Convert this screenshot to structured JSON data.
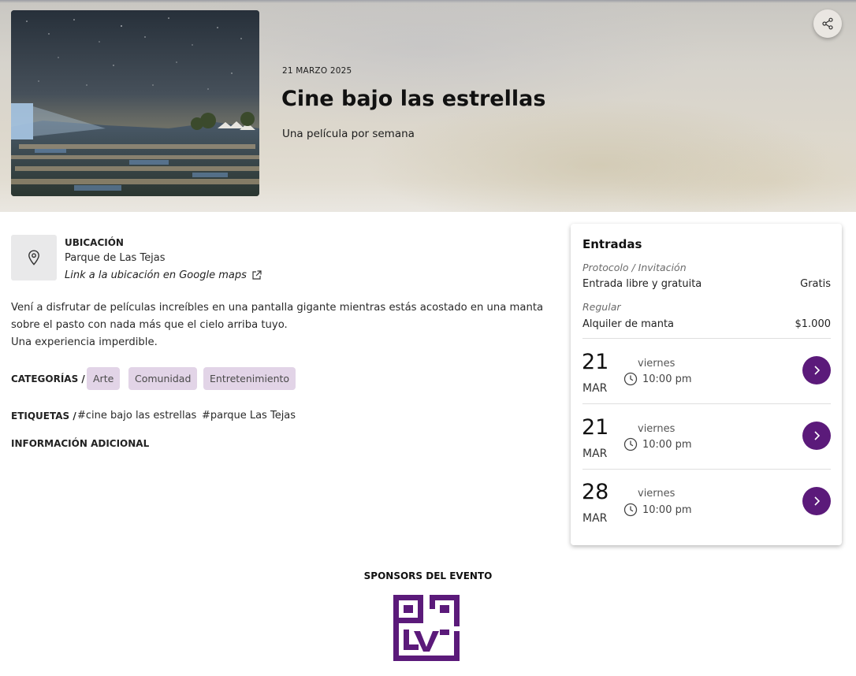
{
  "hero": {
    "date": "21 MARZO 2025",
    "title": "Cine bajo las estrellas",
    "subtitle": "Una película por semana",
    "image_icon": "event-photo",
    "share_icon": "share-icon"
  },
  "location": {
    "heading": "UBICACIÓN",
    "name": "Parque de Las Tejas",
    "link_label": "Link a la ubicación en Google maps",
    "icon": "map-pin-icon"
  },
  "description": {
    "line1": "Vení a disfrutar de películas increíbles en una pantalla gigante mientras estás acostado en una manta sobre el pasto con nada más que el cielo arriba tuyo.",
    "line2": "Una experiencia imperdible."
  },
  "categories": {
    "label": "CATEGORÍAS /",
    "items": [
      "Arte",
      "Comunidad",
      "Entretenimiento"
    ]
  },
  "tags": {
    "label": "ETIQUETAS /",
    "items": [
      "#cine bajo las estrellas",
      "#parque Las Tejas"
    ]
  },
  "additional_info": {
    "label": "INFORMACIÓN ADICIONAL"
  },
  "tickets": {
    "title": "Entradas",
    "groups": [
      {
        "category": "Protocolo / Invitación",
        "name": "Entrada libre y gratuita",
        "price": "Gratis"
      },
      {
        "category": "Regular",
        "name": "Alquiler de manta",
        "price": "$1.000"
      }
    ],
    "dates": [
      {
        "day": "21",
        "month": "MAR",
        "weekday": "viernes",
        "time": "10:00 pm"
      },
      {
        "day": "21",
        "month": "MAR",
        "weekday": "viernes",
        "time": "10:00 pm"
      },
      {
        "day": "28",
        "month": "MAR",
        "weekday": "viernes",
        "time": "10:00 pm"
      }
    ]
  },
  "sponsors": {
    "title": "SPONSORS DEL EVENTO",
    "logo_color": "#5b1a7a"
  },
  "colors": {
    "accent": "#5b1a7a",
    "chip_bg": "#e2d4e7"
  }
}
